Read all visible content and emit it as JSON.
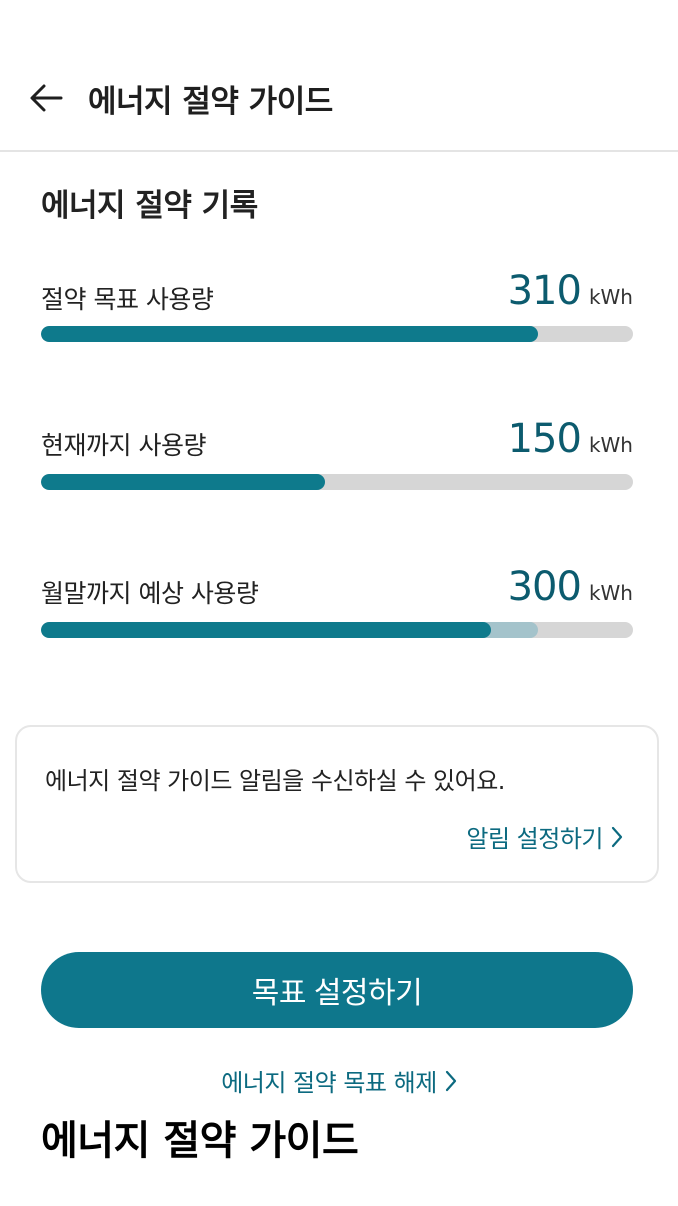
{
  "header": {
    "title": "에너지 절약 가이드",
    "back_icon": "arrow-left-icon"
  },
  "record": {
    "title": "에너지 절약 기록",
    "metrics": [
      {
        "label": "절약 목표 사용량",
        "value": "310",
        "unit": "kWh",
        "fill_fraction": 0.84
      },
      {
        "label": "현재까지 사용량",
        "value": "150",
        "unit": "kWh",
        "fill_fraction": 0.48
      },
      {
        "label": "월말까지 예상 사용량",
        "value": "300",
        "unit": "kWh",
        "fill_fraction": 0.76,
        "secondary_fill_fraction": 0.84
      }
    ]
  },
  "notice": {
    "text": "에너지 절약 가이드 알림을 수신하실 수 있어요.",
    "link_label": "알림 설정하기",
    "link_icon": "chevron-right-icon"
  },
  "actions": {
    "primary_label": "목표 설정하기",
    "secondary_label": "에너지 절약 목표 해제",
    "secondary_icon": "chevron-right-icon"
  },
  "footer": {
    "title": "에너지 절약 가이드"
  },
  "colors": {
    "accent": "#0e7a8c",
    "accent_text": "#0c6a80",
    "track": "#d6d6d6",
    "projection": "#a4c3cb"
  }
}
